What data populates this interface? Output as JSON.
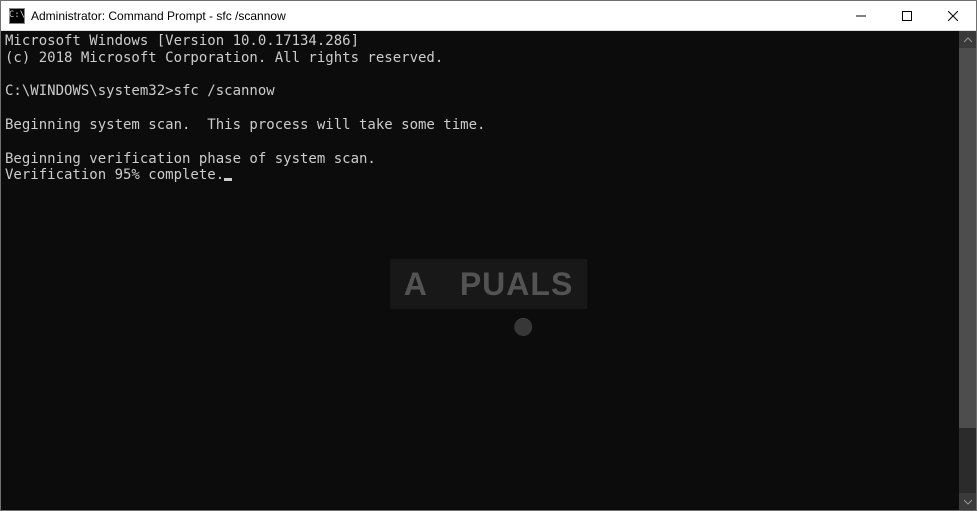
{
  "window": {
    "title": "Administrator: Command Prompt - sfc  /scannow",
    "icon_label": "cmd-icon",
    "icon_text": "C:\\"
  },
  "controls": {
    "minimize": "Minimize",
    "maximize": "Maximize",
    "close": "Close"
  },
  "terminal": {
    "line1": "Microsoft Windows [Version 10.0.17134.286]",
    "line2": "(c) 2018 Microsoft Corporation. All rights reserved.",
    "blank1": "",
    "prompt_line": "C:\\WINDOWS\\system32>sfc /scannow",
    "blank2": "",
    "scan1": "Beginning system scan.  This process will take some time.",
    "blank3": "",
    "scan2": "Beginning verification phase of system scan.",
    "progress": "Verification 95% complete."
  },
  "watermark": {
    "prefix": "A",
    "suffix": "PUALS"
  }
}
